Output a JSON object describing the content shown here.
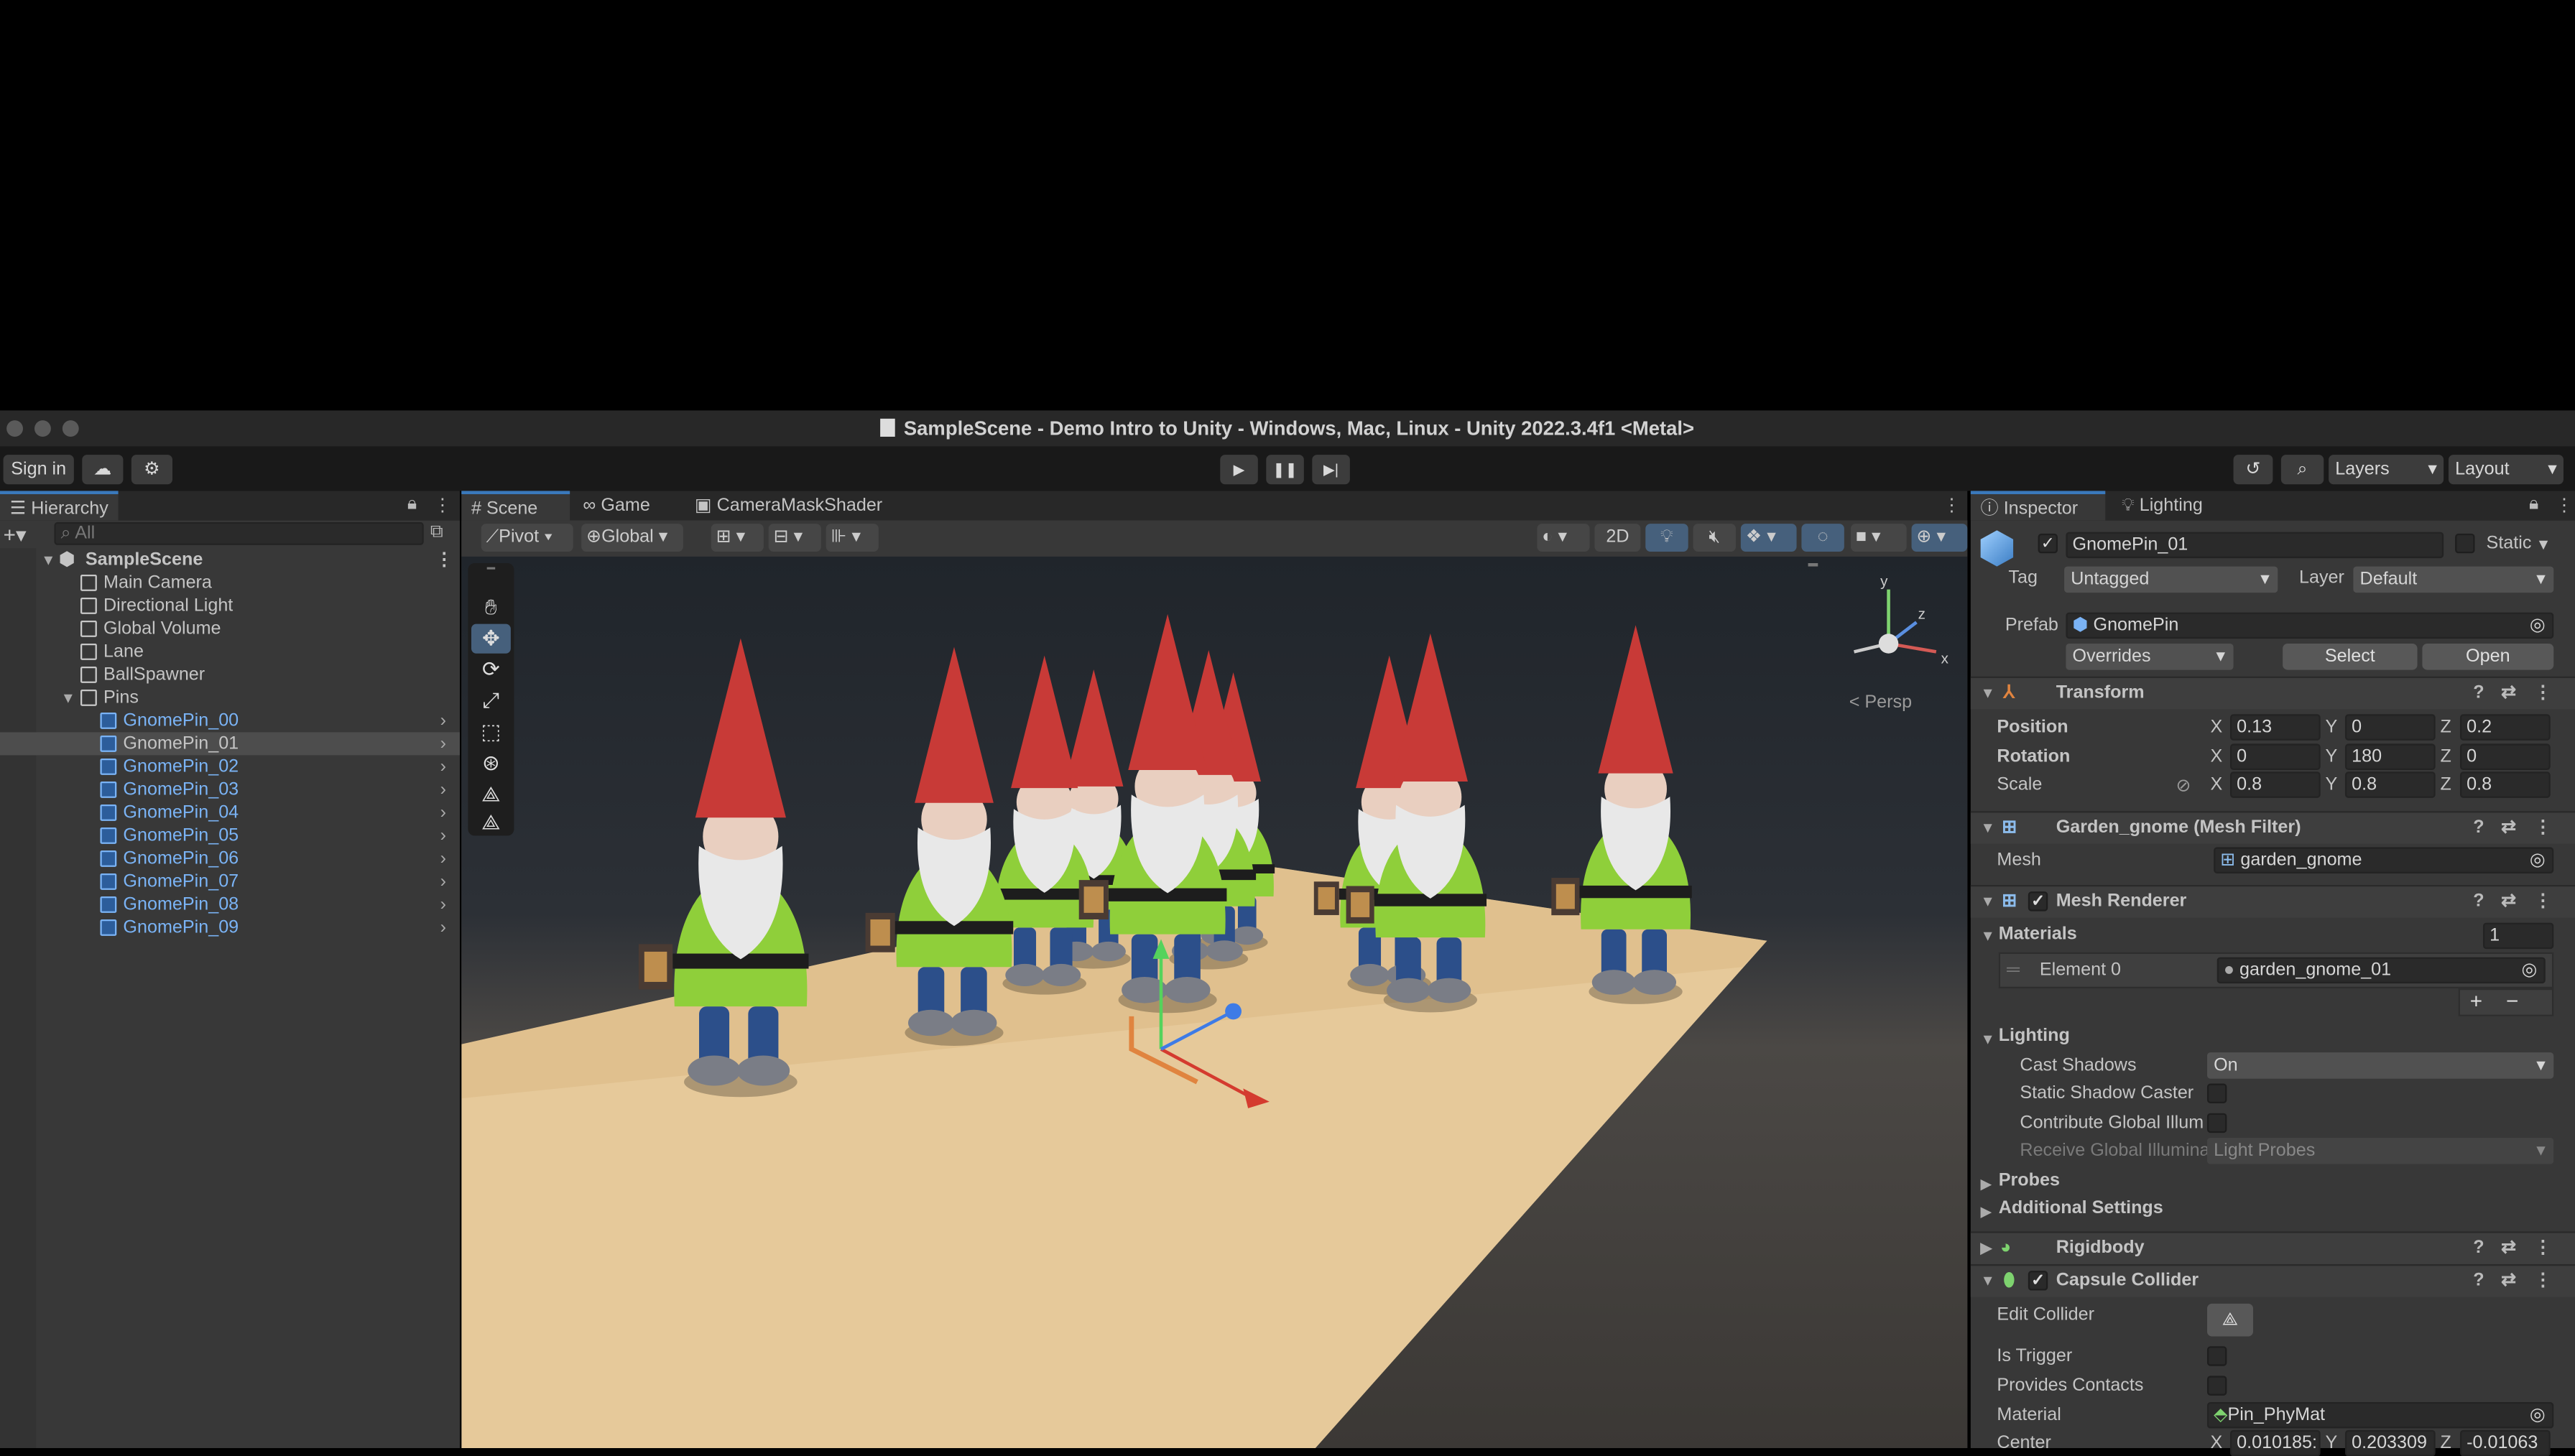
{
  "window": {
    "title": "SampleScene - Demo Intro to Unity - Windows, Mac, Linux - Unity 2022.3.4f1 <Metal>"
  },
  "toolbar": {
    "sign_in": "Sign in",
    "layers": "Layers",
    "layout": "Layout"
  },
  "hierarchy": {
    "tab": "Hierarchy",
    "search_placeholder": "All",
    "scene": "SampleScene",
    "items": [
      "Main Camera",
      "Directional Light",
      "Global Volume",
      "Lane",
      "BallSpawner",
      "Pins"
    ],
    "pins": [
      "GnomePin_00",
      "GnomePin_01",
      "GnomePin_02",
      "GnomePin_03",
      "GnomePin_04",
      "GnomePin_05",
      "GnomePin_06",
      "GnomePin_07",
      "GnomePin_08",
      "GnomePin_09"
    ]
  },
  "scene_tabs": {
    "scene": "Scene",
    "game": "Game",
    "mask": "CameraMaskShader"
  },
  "scene_toolbar": {
    "pivot": "Pivot",
    "global": "Global",
    "mode2d": "2D",
    "persp": "< Persp"
  },
  "gizmo": {
    "x": "x",
    "y": "y",
    "z": "z"
  },
  "inspector": {
    "tab": "Inspector",
    "lighting_tab": "Lighting",
    "object_name": "GnomePin_01",
    "static": "Static",
    "tag_label": "Tag",
    "tag": "Untagged",
    "layer_label": "Layer",
    "layer": "Default",
    "prefab_label": "Prefab",
    "prefab": "GnomePin",
    "overrides": "Overrides",
    "select": "Select",
    "open": "Open",
    "transform": {
      "title": "Transform",
      "position": "Position",
      "rotation": "Rotation",
      "scale": "Scale",
      "pos": [
        "0.13",
        "0",
        "0.2"
      ],
      "rot": [
        "0",
        "180",
        "0"
      ],
      "scl": [
        "0.8",
        "0.8",
        "0.8"
      ],
      "x": "X",
      "y": "Y",
      "z": "Z"
    },
    "mesh_filter": {
      "title": "Garden_gnome (Mesh Filter)",
      "mesh_label": "Mesh",
      "mesh": "garden_gnome"
    },
    "mesh_renderer": {
      "title": "Mesh Renderer",
      "materials": "Materials",
      "count": "1",
      "element0": "Element 0",
      "material": "garden_gnome_01",
      "lighting": "Lighting",
      "cast_shadows": "Cast Shadows",
      "cast_value": "On",
      "static_shadow": "Static Shadow Caster",
      "contribute_gi": "Contribute Global Illum",
      "receive_gi": "Receive Global Illumina",
      "receive_value": "Light Probes",
      "probes": "Probes",
      "additional": "Additional Settings"
    },
    "rigidbody": {
      "title": "Rigidbody"
    },
    "capsule": {
      "title": "Capsule Collider",
      "edit": "Edit Collider",
      "trigger": "Is Trigger",
      "contacts": "Provides Contacts",
      "material_label": "Material",
      "material": "Pin_PhyMat",
      "center": "Center",
      "center_vals": [
        "0.010185:",
        "0.203309",
        "-0.01063"
      ]
    }
  },
  "colors": {
    "accent": "#3a79bb",
    "selected_text": "#7ab3f5"
  }
}
